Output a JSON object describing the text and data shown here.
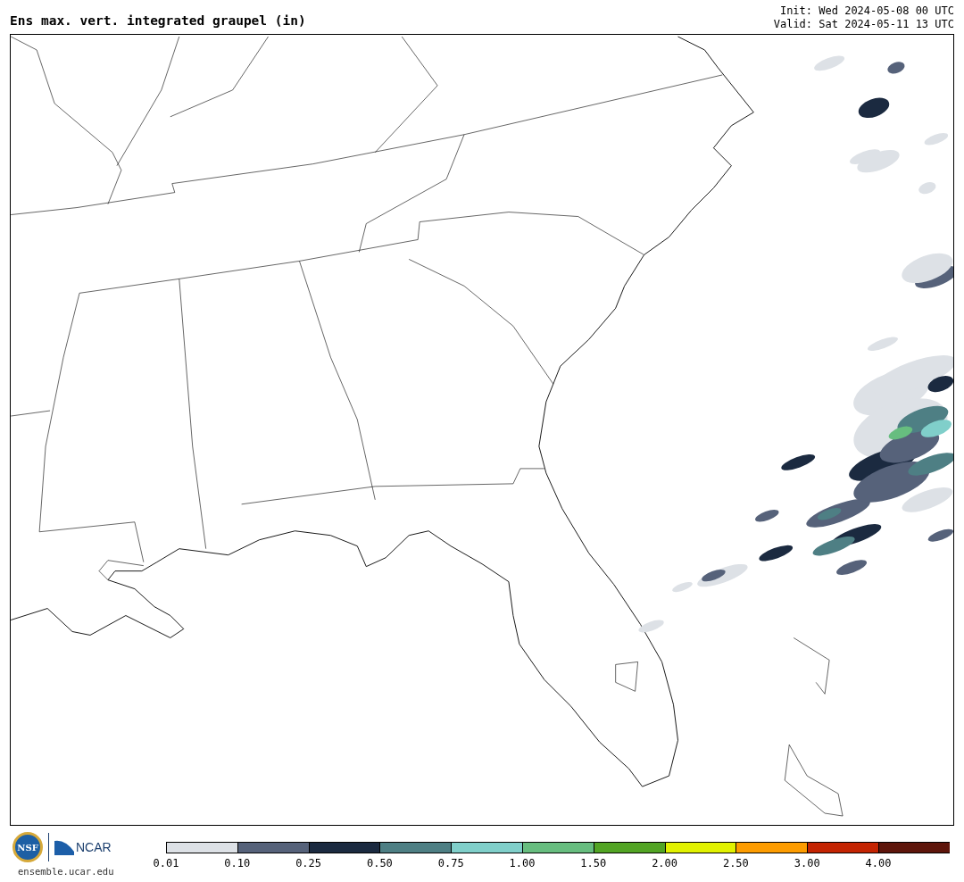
{
  "title": "Ens max. vert. integrated graupel (in)",
  "init": "Init: Wed 2024-05-08 00 UTC",
  "valid": "Valid: Sat 2024-05-11 13 UTC",
  "logos": {
    "nsf": "NSF",
    "ncar": "NCAR"
  },
  "site": "ensemble.ucar.edu",
  "colorbar": [
    {
      "label": "0.01",
      "color": "#dde1e6"
    },
    {
      "label": "0.10",
      "color": "#56627a"
    },
    {
      "label": "0.25",
      "color": "#1b2a40"
    },
    {
      "label": "0.50",
      "color": "#4e7f84"
    },
    {
      "label": "0.75",
      "color": "#80cfca"
    },
    {
      "label": "1.00",
      "color": "#67bd7f"
    },
    {
      "label": "1.50",
      "color": "#52a424"
    },
    {
      "label": "2.00",
      "color": "#e1f100"
    },
    {
      "label": "2.50",
      "color": "#fd9c00"
    },
    {
      "label": "3.00",
      "color": "#c42402"
    },
    {
      "label": "4.00",
      "color": "#5e150b"
    }
  ]
}
